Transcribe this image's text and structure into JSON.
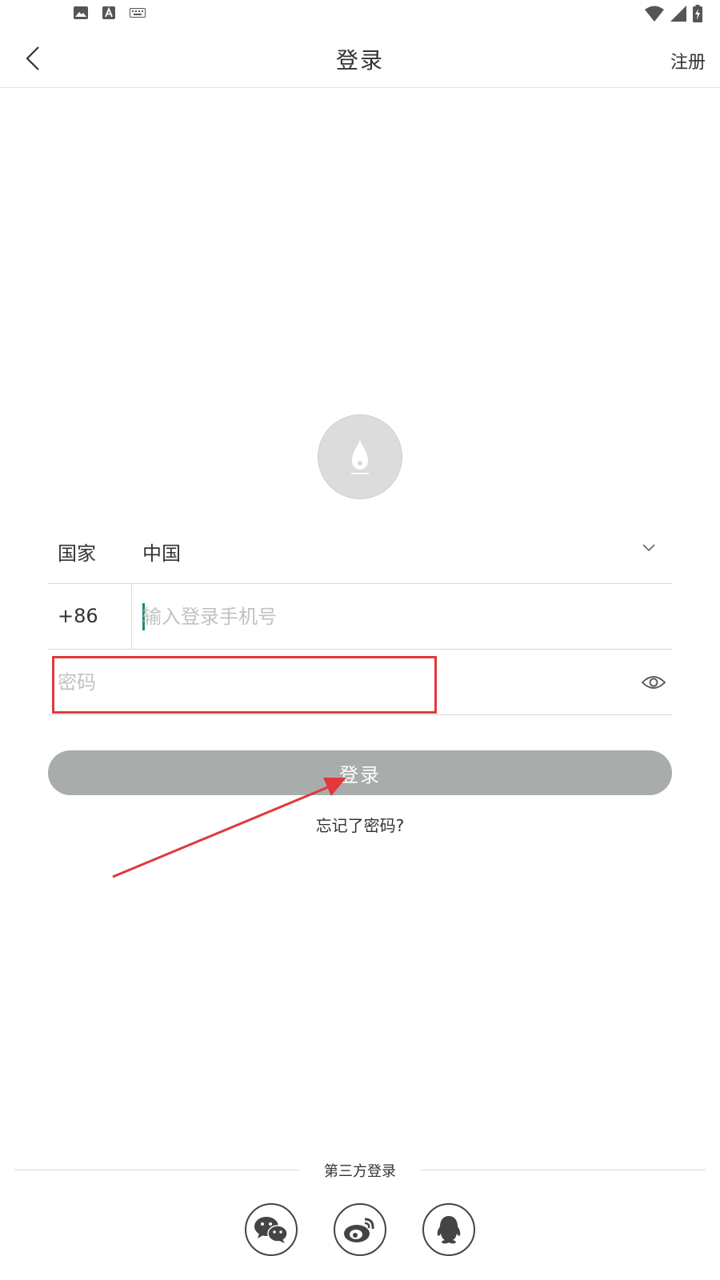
{
  "header": {
    "title": "登录",
    "register_label": "注册"
  },
  "icons": {
    "back": "chevron-left-icon",
    "dropdown": "chevron-down-icon",
    "password_visibility": "eye-icon",
    "logo": "flame-logo-icon",
    "status_left": [
      "image-icon",
      "text-icon",
      "keyboard-icon"
    ],
    "status_right": [
      "wifi-icon",
      "cell-signal-icon",
      "battery-charging-icon"
    ],
    "social": [
      "wechat-icon",
      "weibo-icon",
      "qq-icon"
    ]
  },
  "form": {
    "country_label": "国家",
    "country_value": "中国",
    "country_code": "+86",
    "phone_placeholder": "输入登录手机号",
    "password_placeholder": "密码",
    "login_label": "登录",
    "forgot_label": "忘记了密码?"
  },
  "third_party": {
    "label": "第三方登录"
  },
  "colors": {
    "annotation": "#e0383c",
    "button": "#a8adab",
    "caret": "#1a8a7a"
  }
}
